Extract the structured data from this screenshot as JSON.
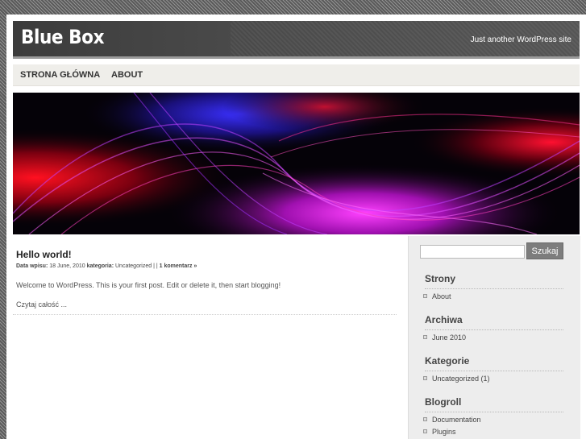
{
  "header": {
    "site_title": "Blue Box",
    "tagline": "Just another WordPress site"
  },
  "nav": {
    "items": [
      {
        "label": "STRONA GŁÓWNA"
      },
      {
        "label": "ABOUT"
      }
    ]
  },
  "post": {
    "title": "Hello world!",
    "meta_date_label": "Data wpisu:",
    "meta_date": "18 June, 2010",
    "meta_category_label": "kategoria:",
    "meta_category": "Uncategorized",
    "meta_separator": "| |",
    "meta_comments": "1 komentarz »",
    "body": "Welcome to WordPress. This is your first post. Edit or delete it, then start blogging!",
    "read_more": "Czytaj całość ..."
  },
  "sidebar": {
    "search": {
      "value": "",
      "placeholder": "",
      "button_label": "Szukaj"
    },
    "widgets": [
      {
        "title": "Strony",
        "items": [
          "About"
        ]
      },
      {
        "title": "Archiwa",
        "items": [
          "June 2010"
        ]
      },
      {
        "title": "Kategorie",
        "items": [
          "Uncategorized (1)"
        ]
      },
      {
        "title": "Blogroll",
        "items": [
          "Documentation",
          "Plugins"
        ]
      }
    ]
  },
  "colors": {
    "header_bg": "#3c3c3c",
    "nav_bg": "#efeeea",
    "sidebar_bg": "#ededed",
    "search_button": "#7d7d7d",
    "banner_accent_magenta": "#d033e0",
    "banner_accent_red": "#e01020",
    "banner_accent_blue": "#2a2ad8"
  }
}
